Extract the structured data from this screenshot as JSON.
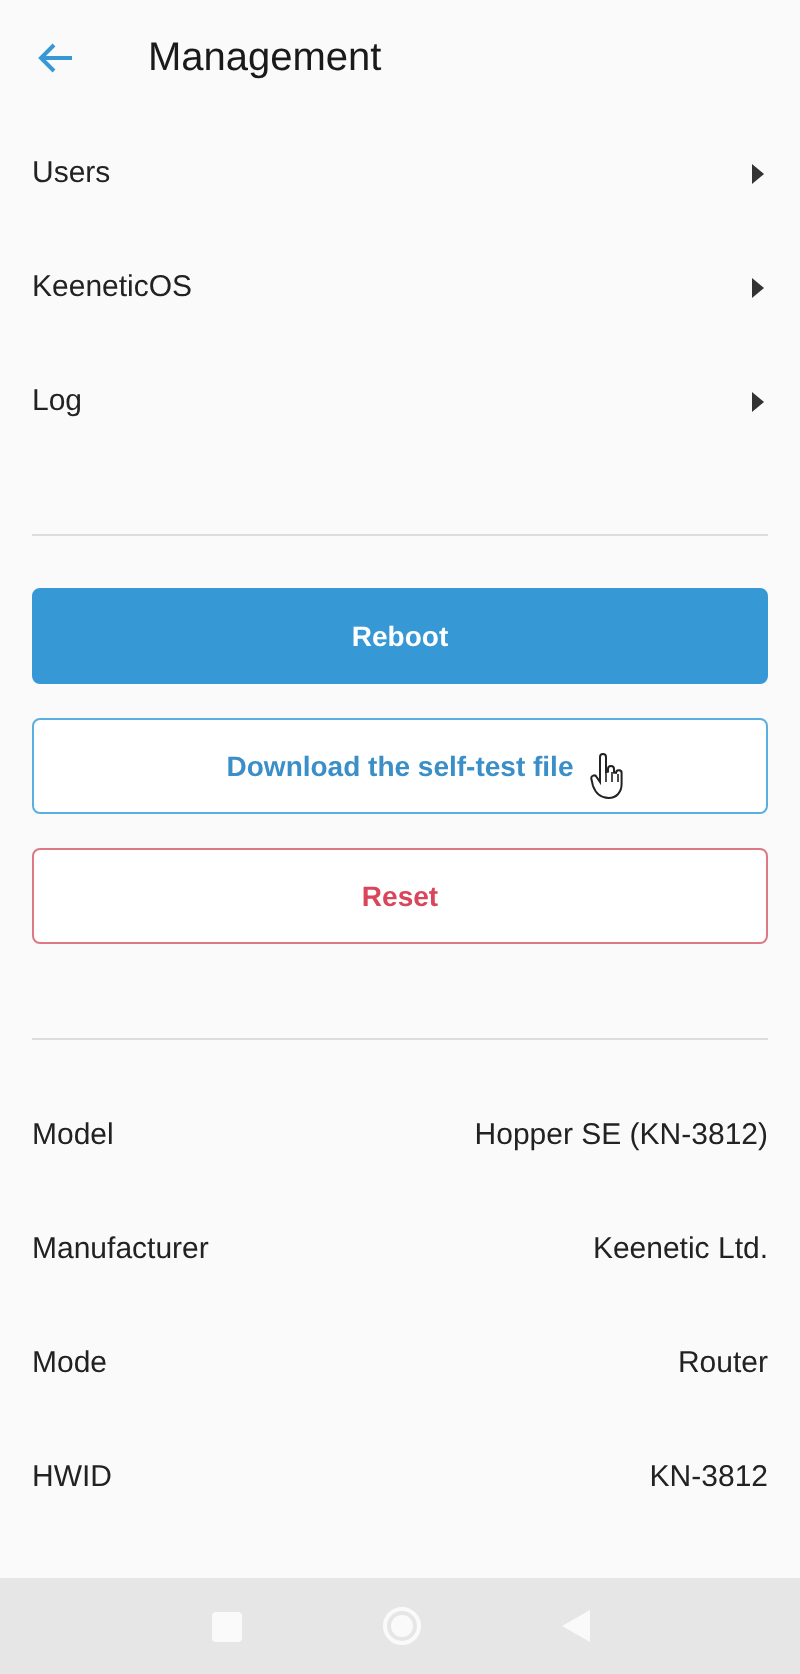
{
  "header": {
    "title": "Management"
  },
  "menu": [
    {
      "label": "Users"
    },
    {
      "label": "KeeneticOS"
    },
    {
      "label": "Log"
    }
  ],
  "actions": [
    {
      "label": "Reboot",
      "kind": "primary",
      "hovered": false
    },
    {
      "label": "Download the self-test file",
      "kind": "outline",
      "hovered": true
    },
    {
      "label": "Reset",
      "kind": "danger",
      "hovered": false
    }
  ],
  "info": [
    {
      "label": "Model",
      "value": "Hopper SE (KN-3812)"
    },
    {
      "label": "Manufacturer",
      "value": "Keenetic Ltd."
    },
    {
      "label": "Mode",
      "value": "Router"
    },
    {
      "label": "HWID",
      "value": "KN-3812"
    }
  ]
}
